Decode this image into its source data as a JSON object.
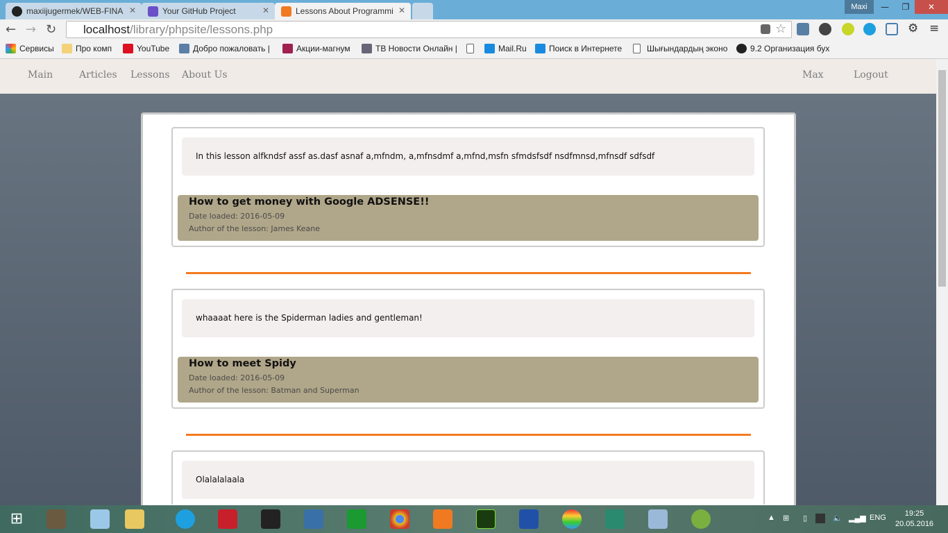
{
  "browser": {
    "tabs": [
      {
        "label": "maxiijugermek/WEB-FINA",
        "icon": "github-icon"
      },
      {
        "label": "Your GitHub Project",
        "icon": "list-icon"
      },
      {
        "label": "Lessons About Programmi",
        "icon": "xampp-icon"
      }
    ],
    "user": "Maxi",
    "url_host": "localhost",
    "url_path": "/library/phpsite/lessons.php",
    "bookmarks": [
      "Сервисы",
      "Про комп",
      "YouTube",
      "Добро пожаловать |",
      "Акции-магнум",
      "ТВ Новости Онлайн |",
      "",
      "Mail.Ru",
      "Поиск в Интернете",
      "Шығындардың эконо",
      "9.2 Организация бух"
    ]
  },
  "nav": {
    "main": "Main",
    "articles": "Articles",
    "lessons": "Lessons",
    "about": "About Us",
    "user": "Max",
    "logout": "Logout"
  },
  "lessons": [
    {
      "description": "In this lesson alfkndsf assf as.dasf asnaf a,mfndm, a,mfnsdmf a,mfnd,msfn sfmdsfsdf nsdfmnsd,mfnsdf sdfsdf",
      "title": "How to get money with Google ADSENSE!!",
      "date": "Date loaded: 2016-05-09",
      "author": "Author of the lesson: James Keane"
    },
    {
      "description": "whaaaat here is the Spiderman ladies and gentleman!",
      "title": "How to meet Spidy",
      "date": "Date loaded: 2016-05-09",
      "author": "Author of the lesson: Batman and Superman"
    },
    {
      "description": "Olalalalaala"
    }
  ],
  "taskbar": {
    "lang": "ENG",
    "time": "19:25",
    "date": "20.05.2016"
  },
  "colors": {
    "accent": "#f47a20",
    "meta_bg": "#b0a689",
    "nav_bg": "#f0ebe7"
  }
}
